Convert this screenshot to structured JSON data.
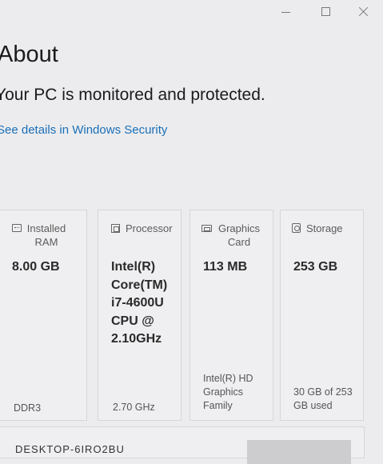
{
  "window": {
    "controls": [
      "minimize-icon",
      "maximize-icon",
      "close-icon"
    ]
  },
  "about": {
    "title": "About",
    "status": "Your PC is monitored and protected.",
    "security_link": "See details in Windows Security"
  },
  "specs": {
    "ram": {
      "icon": "ram-icon",
      "label": "Installed RAM",
      "value": "8.00 GB",
      "detail": "DDR3"
    },
    "processor": {
      "icon": "processor-icon",
      "label": "Processor",
      "value": "Intel(R) Core(TM) i7-4600U CPU @ 2.10GHz",
      "detail": "2.70 GHz"
    },
    "graphics": {
      "icon": "graphics-card-icon",
      "label": "Graphics Card",
      "value": "113 MB",
      "detail": "Intel(R) HD Graphics Family"
    },
    "storage": {
      "icon": "storage-icon",
      "label": "Storage",
      "value": "253 GB",
      "detail": "30 GB of 253 GB used"
    }
  },
  "device": {
    "name": "DESKTOP-6IRO2BU"
  },
  "colors": {
    "background": "#ececee",
    "card": "#efeff1",
    "link": "#1a6fb8",
    "text": "#1b1b1b"
  }
}
